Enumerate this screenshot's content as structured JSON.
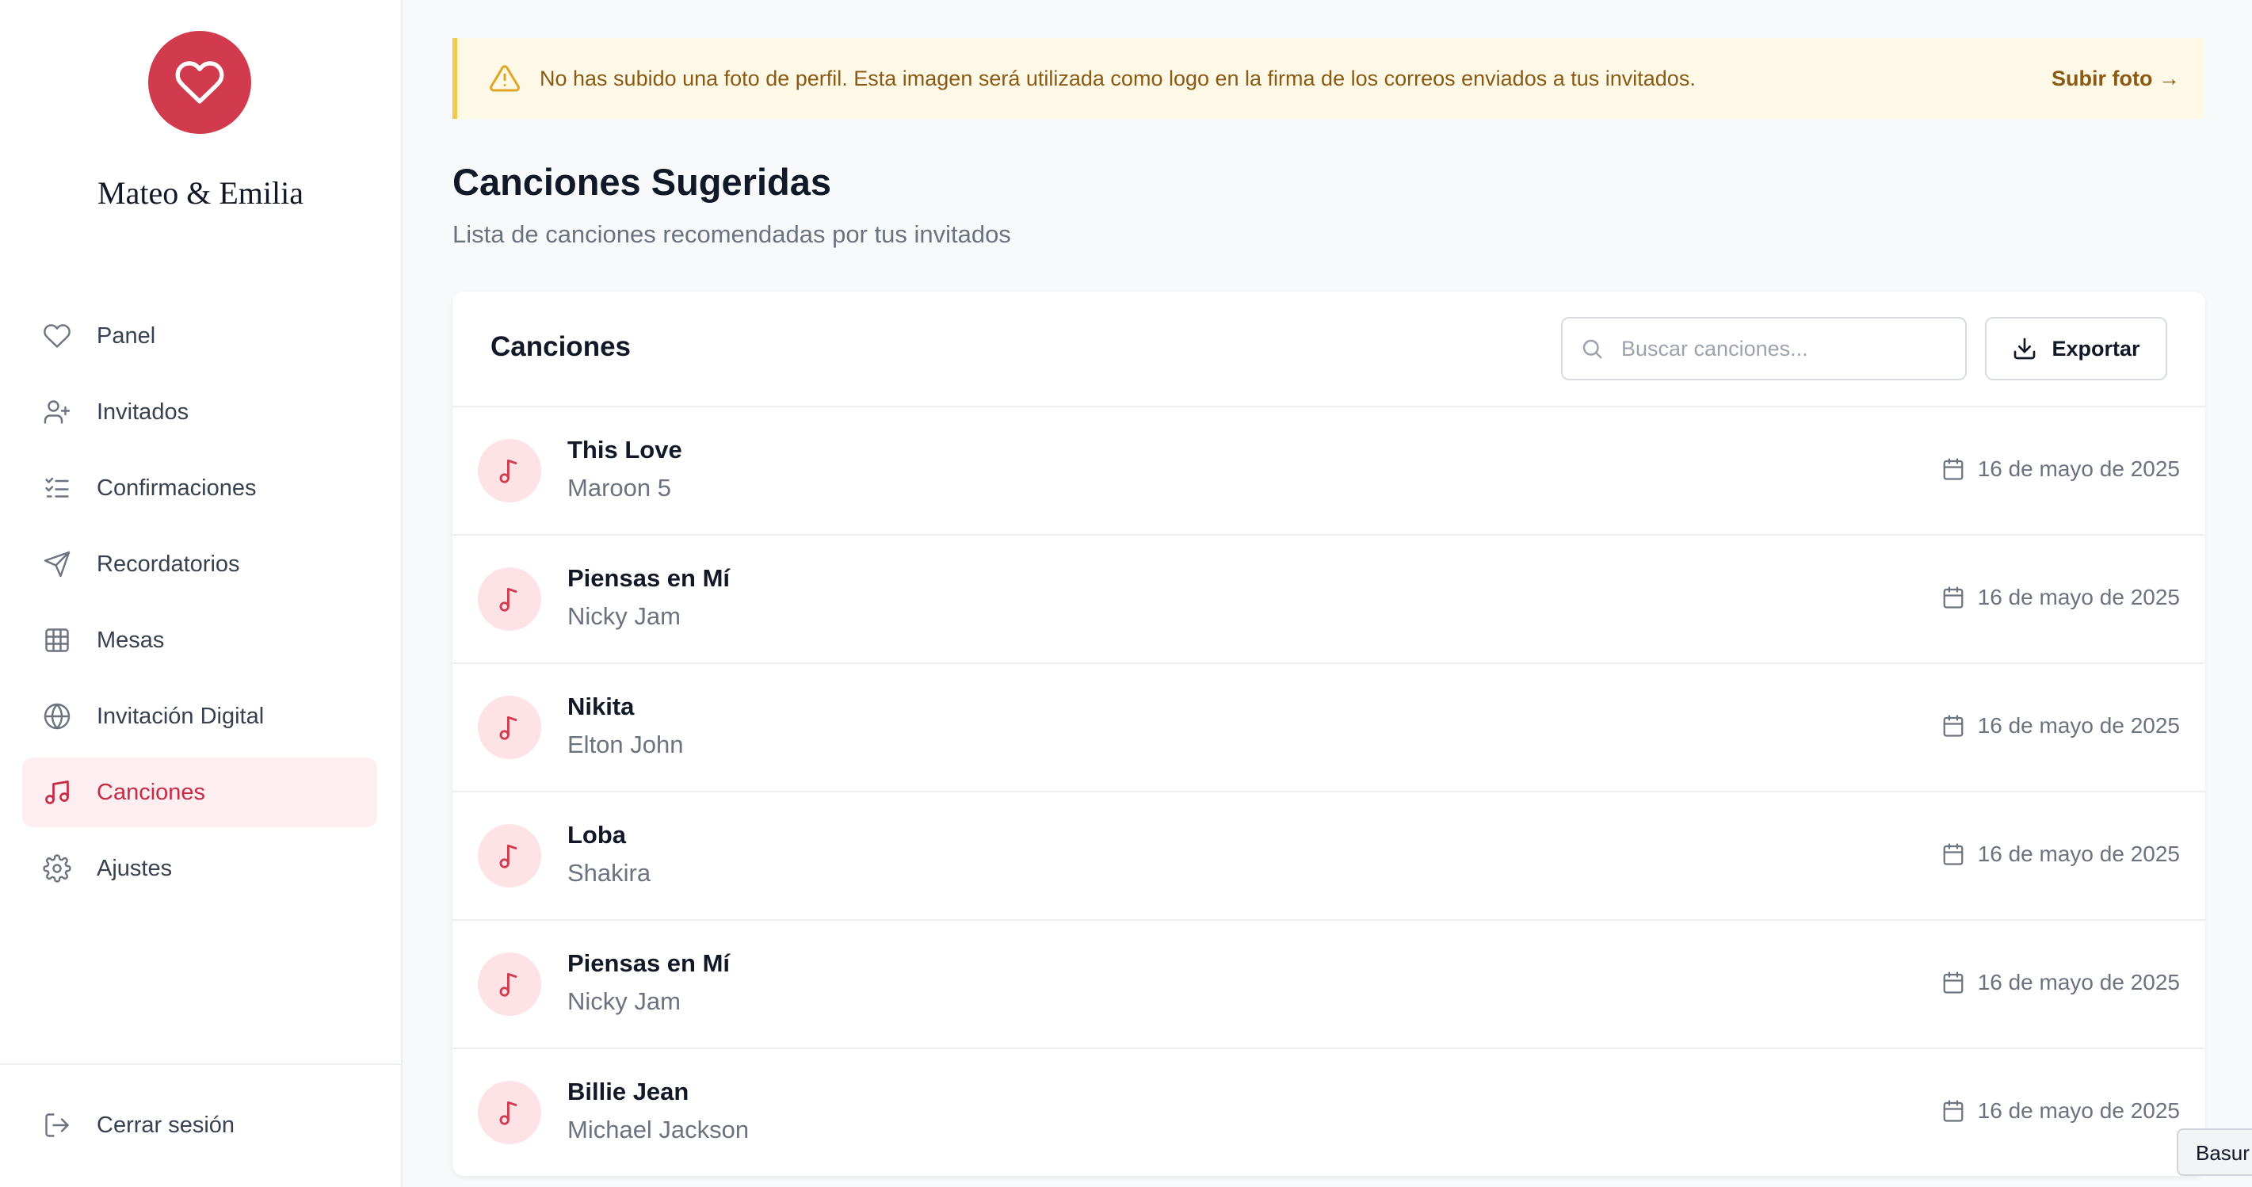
{
  "sidebar": {
    "couple_name": "Mateo & Emilia",
    "items": [
      {
        "label": "Panel",
        "icon": "heart-icon"
      },
      {
        "label": "Invitados",
        "icon": "user-plus-icon"
      },
      {
        "label": "Confirmaciones",
        "icon": "list-checks-icon"
      },
      {
        "label": "Recordatorios",
        "icon": "send-icon"
      },
      {
        "label": "Mesas",
        "icon": "grid-icon"
      },
      {
        "label": "Invitación Digital",
        "icon": "globe-icon"
      },
      {
        "label": "Canciones",
        "icon": "music-icon",
        "active": true
      },
      {
        "label": "Ajustes",
        "icon": "gear-icon"
      }
    ],
    "logout_label": "Cerrar sesión"
  },
  "banner": {
    "text": "No has subido una foto de perfil. Esta imagen será utilizada como logo en la firma de los correos enviados a tus invitados.",
    "link_label": "Subir foto →"
  },
  "page": {
    "title": "Canciones Sugeridas",
    "subtitle": "Lista de canciones recomendadas por tus invitados"
  },
  "card": {
    "title": "Canciones",
    "search_placeholder": "Buscar canciones...",
    "export_label": "Exportar"
  },
  "songs": [
    {
      "title": "This Love",
      "artist": "Maroon 5",
      "date": "16 de mayo de 2025"
    },
    {
      "title": "Piensas en Mí",
      "artist": "Nicky Jam",
      "date": "16 de mayo de 2025"
    },
    {
      "title": "Nikita",
      "artist": "Elton John",
      "date": "16 de mayo de 2025"
    },
    {
      "title": "Loba",
      "artist": "Shakira",
      "date": "16 de mayo de 2025"
    },
    {
      "title": "Piensas en Mí",
      "artist": "Nicky Jam",
      "date": "16 de mayo de 2025"
    },
    {
      "title": "Billie Jean",
      "artist": "Michael Jackson",
      "date": "16 de mayo de 2025"
    }
  ],
  "tooltip": {
    "text": "Basur"
  },
  "colors": {
    "accent": "#d23a4e",
    "active_bg": "#fdeff1",
    "banner_bg": "#fef9e7",
    "banner_border": "#f2c94c",
    "banner_text": "#8a5a14"
  }
}
